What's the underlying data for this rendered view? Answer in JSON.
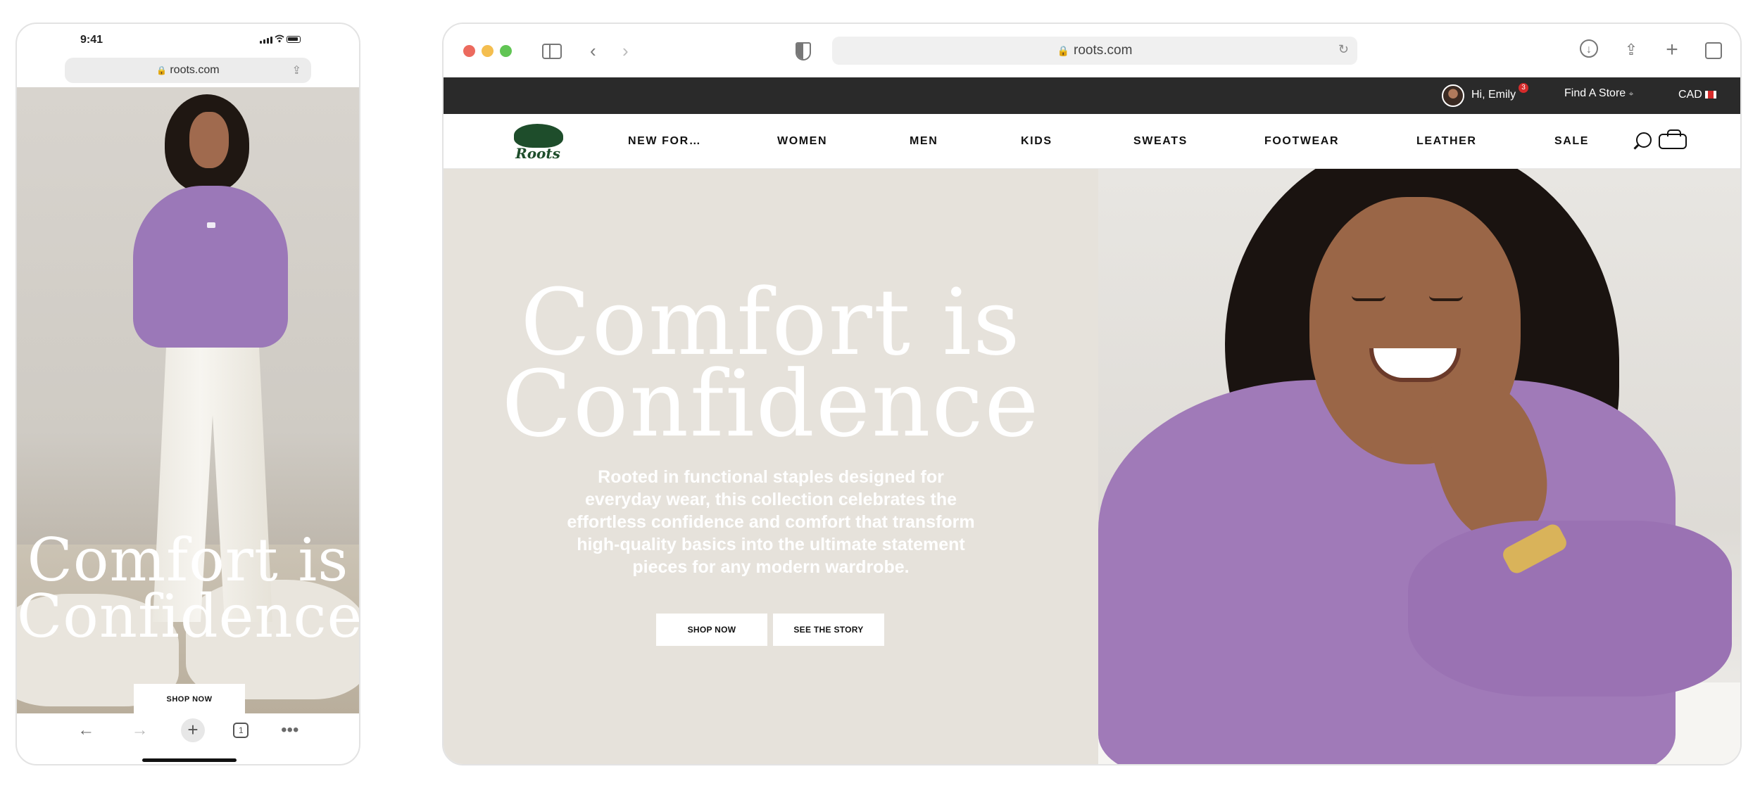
{
  "phone": {
    "status_time": "9:41",
    "url": "roots.com",
    "hero_title": "Comfort is Confidence",
    "shop_button": "SHOP NOW",
    "tab_count": "1"
  },
  "browser": {
    "url": "roots.com",
    "topbar": {
      "greeting": "Hi, Emily",
      "notification_count": "3",
      "store_link": "Find A Store",
      "currency": "CAD"
    },
    "brand": "Roots",
    "nav": [
      "NEW FOR…",
      "WOMEN",
      "MEN",
      "KIDS",
      "SWEATS",
      "FOOTWEAR",
      "LEATHER",
      "SALE"
    ],
    "hero": {
      "title": "Comfort is Confidence",
      "copy": "Rooted in functional staples designed for everyday wear, this collection celebrates the effortless confidence and comfort that transform high-quality basics into the ultimate statement pieces for any modern wardrobe.",
      "primary_button": "SHOP NOW",
      "secondary_button": "SEE THE STORY"
    }
  },
  "colors": {
    "topbar_bg": "#2a2a2a",
    "hero_left_bg": "#e6e2db",
    "brand_green": "#1e4d2b",
    "sweater_purple": "#9b78b8",
    "badge_red": "#d62b2b"
  },
  "icons": [
    "lock-icon",
    "share-icon",
    "back-icon",
    "forward-icon",
    "plus-icon",
    "tabs-icon",
    "more-icon",
    "sidebar-icon",
    "shield-icon",
    "reload-icon",
    "download-icon",
    "new-tab-icon",
    "tab-overview-icon",
    "location-pin-icon",
    "flag-icon",
    "search-icon",
    "bag-icon"
  ]
}
